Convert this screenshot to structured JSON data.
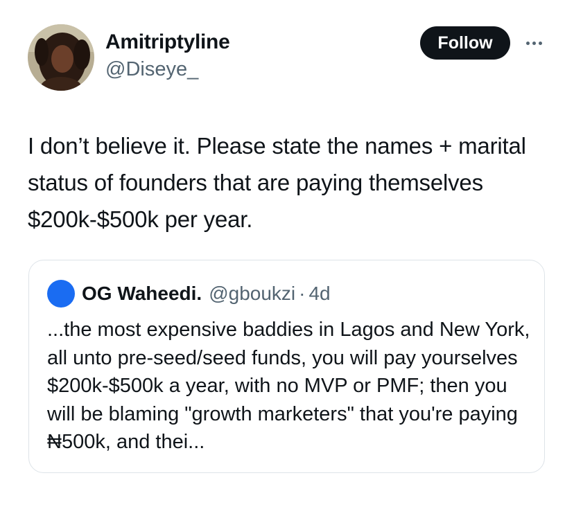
{
  "author": {
    "display_name": "Amitriptyline",
    "handle": "@Diseye_"
  },
  "actions": {
    "follow_label": "Follow",
    "more_icon": "more-horizontal-icon"
  },
  "tweet": {
    "text": "I don’t believe it. Please state the names + marital status of founders that are paying themselves $200k-$500k per year."
  },
  "quoted_tweet": {
    "display_name": "OG Waheedi.",
    "handle": "@gboukzi",
    "separator": "·",
    "time": "4d",
    "avatar_color": "#1a6cf2",
    "text": "...the most expensive baddies in Lagos and New York, all unto pre-seed/seed funds, you will pay yourselves $200k-$500k a year, with no MVP or PMF; then you will be blaming \"growth marketers\" that you're paying ₦500k, and thei..."
  },
  "colors": {
    "primary_text": "#0f1419",
    "secondary_text": "#536471",
    "border": "#dde3e8",
    "follow_button_bg": "#0f1419"
  }
}
